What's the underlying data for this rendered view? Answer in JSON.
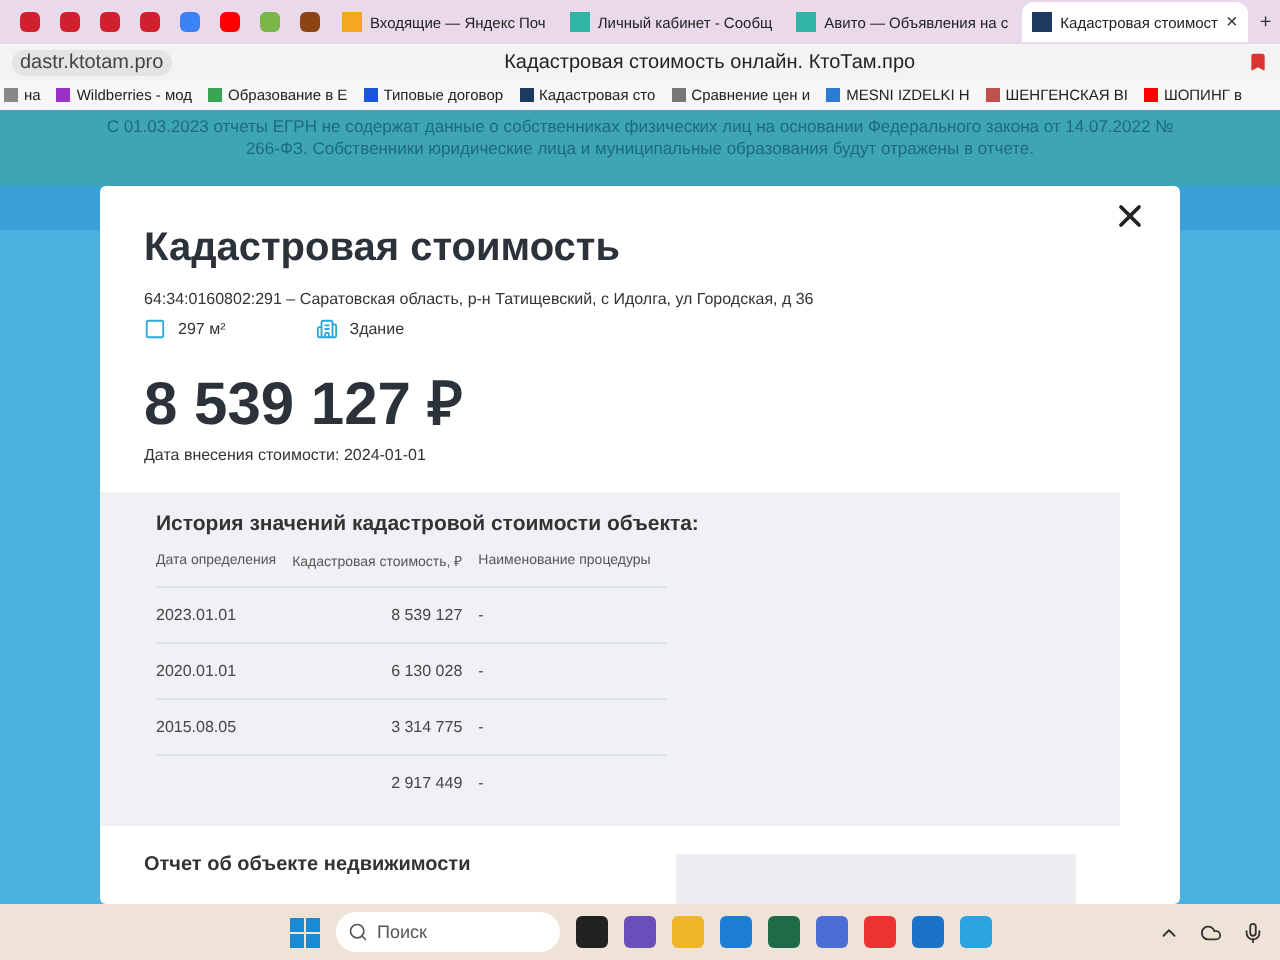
{
  "browser": {
    "tabs": [
      {
        "kind": "pinned",
        "color": "#d0202e",
        "selected": false
      },
      {
        "kind": "pinned",
        "color": "#d0202e",
        "selected": false
      },
      {
        "kind": "pinned",
        "color": "#d0202e",
        "selected": false
      },
      {
        "kind": "pinned",
        "color": "#d0202e",
        "selected": false
      },
      {
        "kind": "pinned",
        "color": "#3b82f6",
        "selected": false
      },
      {
        "kind": "pinned",
        "color": "#ff0000",
        "selected": false
      },
      {
        "kind": "pinned",
        "color": "#7ab648",
        "selected": false
      },
      {
        "kind": "pinned",
        "color": "#8b4513",
        "selected": false
      },
      {
        "kind": "titled",
        "title": "Входящие — Яндекс Поч",
        "color": "#f5a623",
        "selected": false
      },
      {
        "kind": "titled",
        "title": "Личный кабинет - Сообщ",
        "color": "#2fb5a8",
        "selected": false
      },
      {
        "kind": "titled",
        "title": "Авито — Объявления на с",
        "color": "#2fb5a8",
        "selected": false
      },
      {
        "kind": "titled",
        "title": "Кадастровая стоимост",
        "color": "#1e3a5f",
        "selected": true
      }
    ],
    "new_tab": "+",
    "close_tab": "×",
    "address": "dastr.ktotam.pro",
    "page_title": "Кадастровая стоимость онлайн. КтоТам.про",
    "bookmarks": [
      {
        "label": "на",
        "color": "#888888"
      },
      {
        "label": "Wildberries - мод",
        "color": "#9b30c9"
      },
      {
        "label": "Образование в Е",
        "color": "#3aa655"
      },
      {
        "label": "Типовые договор",
        "color": "#1a56db"
      },
      {
        "label": "Кадастровая сто",
        "color": "#1e3a5f"
      },
      {
        "label": "Сравнение цен и",
        "color": "#777777"
      },
      {
        "label": "MESNI IZDELKI Н",
        "color": "#2a7bd4"
      },
      {
        "label": "ШЕНГЕНСКАЯ ВІ",
        "color": "#c0504d"
      },
      {
        "label": "ШОПИНГ в",
        "color": "#ff0000"
      }
    ]
  },
  "notice": "С 01.03.2023 отчеты ЕГРН не содержат данные о собственниках физических лиц на основании Федерального закона от 14.07.2022 № 266-ФЗ. Собственники юридические лица и муниципальные образования будут отражены в отчете.",
  "modal": {
    "title": "Кадастровая стоимость",
    "address": "64:34:0160802:291 – Саратовская область, р-н Татищевский, с Идолга, ул Городская, д 36",
    "area": "297 м²",
    "type": "Здание",
    "price": "8 539 127 ₽",
    "date": "Дата внесения стоимости: 2024-01-01",
    "history": {
      "title": "История значений кадастровой стоимости объекта:",
      "columns": [
        "Дата определения",
        "Кадастровая стоимость, ₽",
        "Наименование процедуры"
      ],
      "rows": [
        [
          "2023.01.01",
          "8 539 127",
          "-"
        ],
        [
          "2020.01.01",
          "6 130 028",
          "-"
        ],
        [
          "2015.08.05",
          "3 314 775",
          "-"
        ],
        [
          "",
          "2 917 449",
          "-"
        ]
      ]
    },
    "report_title": "Отчет об объекте недвижимости"
  },
  "taskbar": {
    "search_placeholder": "Поиск"
  }
}
